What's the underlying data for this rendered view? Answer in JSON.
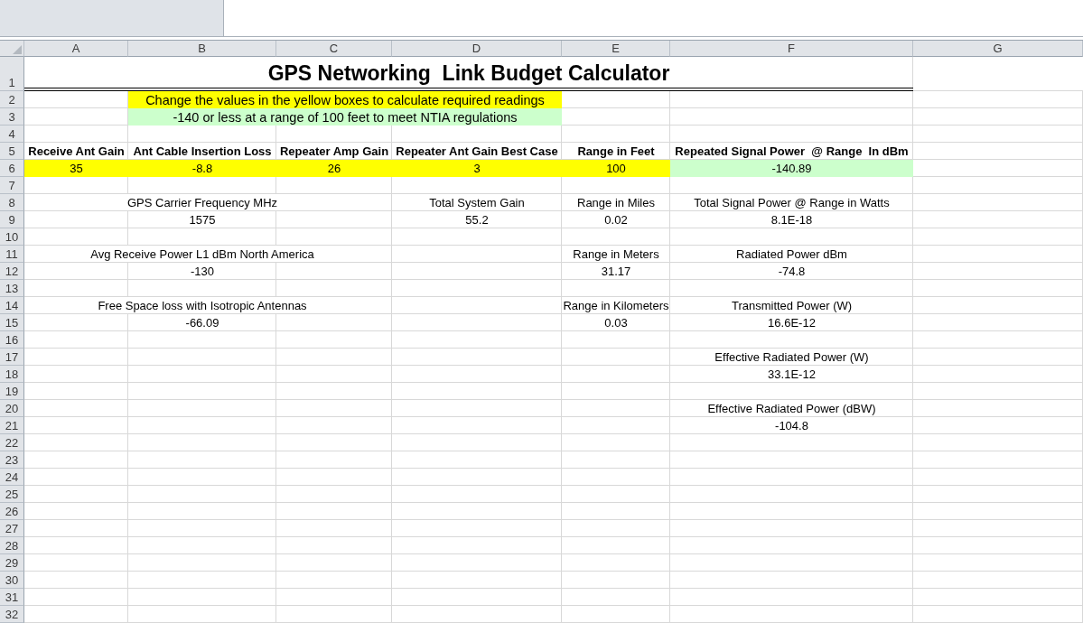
{
  "column_headers": [
    "A",
    "B",
    "C",
    "D",
    "E",
    "F",
    "G"
  ],
  "row_headers": [
    "1",
    "2",
    "3",
    "4",
    "5",
    "6",
    "7",
    "8",
    "9",
    "10",
    "11",
    "12",
    "13",
    "14",
    "15",
    "16",
    "17",
    "18",
    "19",
    "20",
    "21",
    "22",
    "23",
    "24",
    "25",
    "26",
    "27",
    "28",
    "29",
    "30",
    "31",
    "32"
  ],
  "title": "GPS Networking  Link Budget Calculator",
  "banners": [
    {
      "text": "Change the values in the yellow boxes to calculate required readings",
      "color": "#ffff00"
    },
    {
      "text": "-140 or less at a range of 100 feet to meet NTIA regulations",
      "color": "#ccffcc"
    }
  ],
  "parameters": [
    {
      "label": "Receive Ant Gain",
      "value": "35",
      "kind": "input"
    },
    {
      "label": "Ant Cable Insertion Loss",
      "value": "-8.8",
      "kind": "input"
    },
    {
      "label": "Repeater Amp Gain",
      "value": "26",
      "kind": "input"
    },
    {
      "label": "Repeater Ant Gain Best Case",
      "value": "3",
      "kind": "input"
    },
    {
      "label": "Range in Feet",
      "value": "100",
      "kind": "input"
    },
    {
      "label": "Repeated Signal Power  @ Range  In dBm",
      "value": "-140.89",
      "kind": "result"
    }
  ],
  "sections": [
    {
      "items": [
        {
          "label": "GPS Carrier Frequency MHz",
          "value": "1575"
        },
        {
          "label": "Avg Receive Power L1 dBm North America",
          "value": "-130"
        },
        {
          "label": "Free Space loss with Isotropic Antennas",
          "value": "-66.09"
        }
      ]
    },
    {
      "items": [
        {
          "label": "Total System Gain",
          "value": "55.2"
        }
      ]
    },
    {
      "items": [
        {
          "label": "Range in Miles",
          "value": "0.02"
        },
        {
          "label": "Range in Meters",
          "value": "31.17"
        },
        {
          "label": "Range in Kilometers",
          "value": "0.03"
        }
      ]
    },
    {
      "items": [
        {
          "label": "Total Signal Power @ Range in Watts",
          "value": "8.1E-18"
        },
        {
          "label": "Radiated Power dBm",
          "value": "-74.8"
        },
        {
          "label": "Transmitted Power (W)",
          "value": "16.6E-12"
        },
        {
          "label": "Effective Radiated Power (W)",
          "value": "33.1E-12"
        },
        {
          "label": "Effective Radiated Power (dBW)",
          "value": "-104.8"
        }
      ]
    }
  ]
}
